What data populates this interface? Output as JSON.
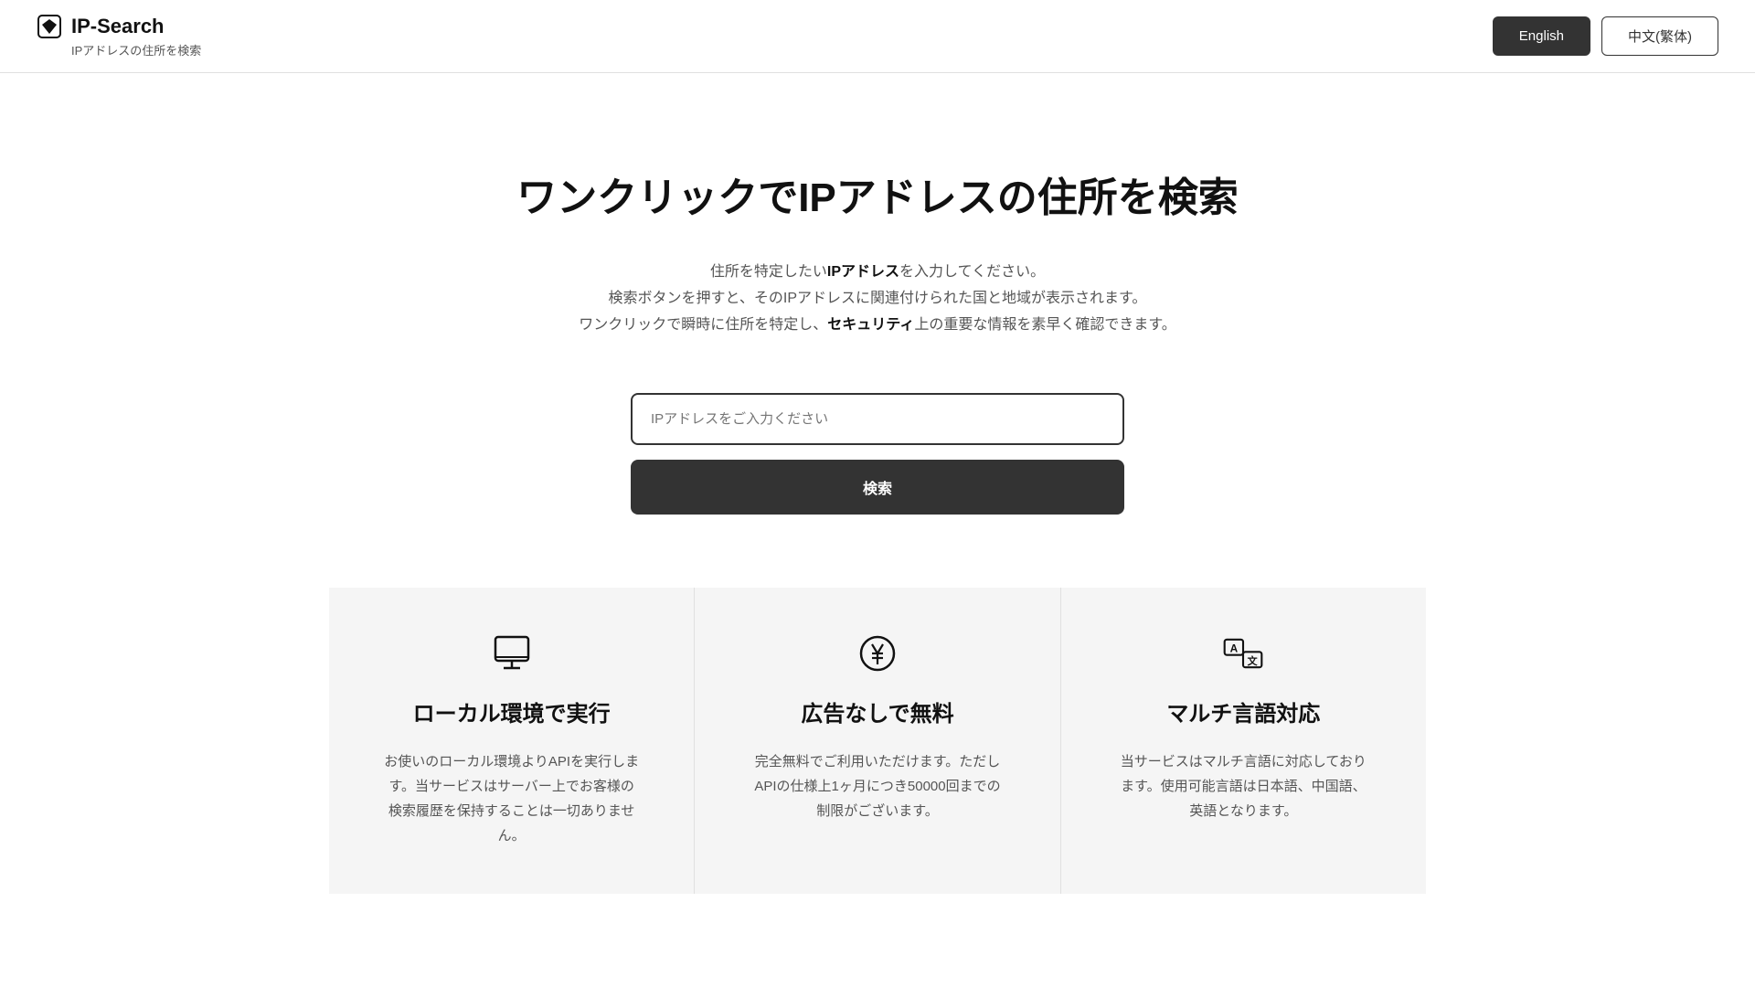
{
  "header": {
    "logo_title": "IP-Search",
    "logo_subtitle": "IPアドレスの住所を検索",
    "lang_english": "English",
    "lang_chinese": "中文(繁体)"
  },
  "main": {
    "title": "ワンクリックでIPアドレスの住所を検索",
    "desc_line1": "住所を特定したいIPアドレスを入力してください。",
    "desc_line2_pre": "検索ボタンを押すと、そのIPアドレスに関連付けられた国と地域が表示されます。",
    "desc_line3_pre": "ワンクリックで瞬時に住所を特定し、",
    "desc_line3_bold": "セキュリティ",
    "desc_line3_post": "上の重要な情報を素早く確認できます。",
    "search_placeholder": "IPアドレスをご入力ください",
    "search_button_label": "検索"
  },
  "features": [
    {
      "id": "local",
      "icon": "monitor",
      "title": "ローカル環境で実行",
      "desc": "お使いのローカル環境よりAPIを実行します。当サービスはサーバー上でお客様の検索履歴を保持することは一切ありません。"
    },
    {
      "id": "free",
      "icon": "yen",
      "title": "広告なしで無料",
      "desc": "完全無料でご利用いただけます。ただしAPIの仕様上1ヶ月につき50000回までの制限がございます。"
    },
    {
      "id": "multilang",
      "icon": "translation",
      "title": "マルチ言語対応",
      "desc": "当サービスはマルチ言語に対応しております。使用可能言語は日本語、中国語、英語となります。"
    }
  ]
}
